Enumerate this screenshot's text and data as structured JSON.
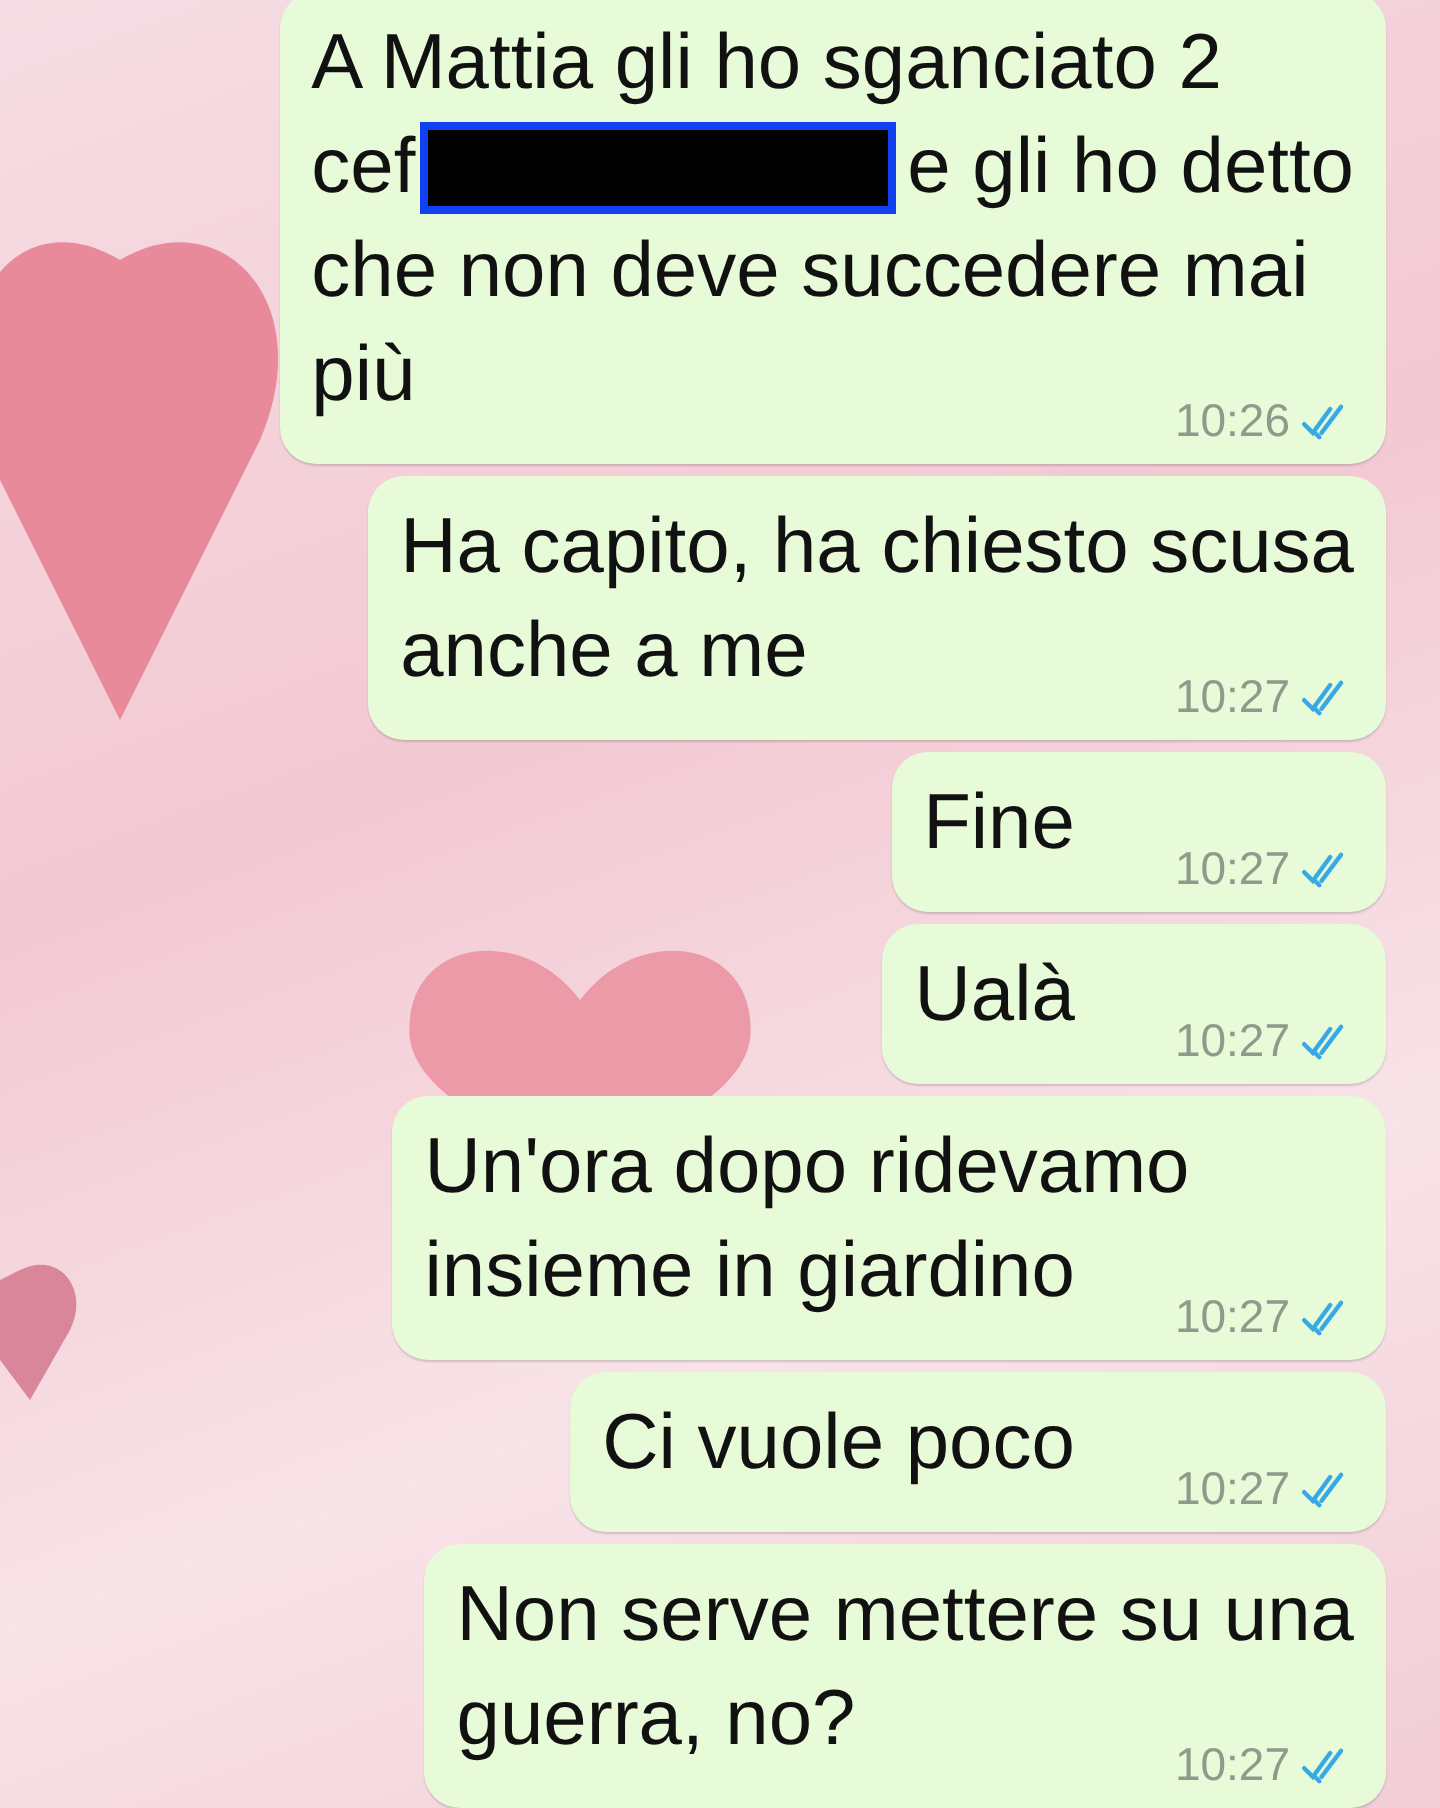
{
  "messages": [
    {
      "lines": [
        {
          "parts": [
            {
              "kind": "text",
              "text": "A Mattia gli ho sganciato 2"
            }
          ]
        },
        {
          "parts": [
            {
              "kind": "text",
              "text": "cef"
            },
            {
              "kind": "redaction"
            },
            {
              "kind": "text",
              "text": "e gli ho detto"
            }
          ]
        },
        {
          "parts": [
            {
              "kind": "text",
              "text": "che non deve succedere mai"
            }
          ]
        },
        {
          "parts": [
            {
              "kind": "text",
              "text": "più"
            }
          ]
        }
      ],
      "time": "10:26",
      "read": true
    },
    {
      "lines": [
        {
          "parts": [
            {
              "kind": "text",
              "text": "Ha capito, ha chiesto scusa"
            }
          ]
        },
        {
          "parts": [
            {
              "kind": "text",
              "text": "anche a me"
            }
          ]
        }
      ],
      "time": "10:27",
      "read": true
    },
    {
      "lines": [
        {
          "parts": [
            {
              "kind": "text",
              "text": "Fine"
            }
          ]
        }
      ],
      "time": "10:27",
      "read": true
    },
    {
      "lines": [
        {
          "parts": [
            {
              "kind": "text",
              "text": "Ualà"
            }
          ]
        }
      ],
      "time": "10:27",
      "read": true
    },
    {
      "lines": [
        {
          "parts": [
            {
              "kind": "text",
              "text": "Un'ora dopo ridevamo"
            }
          ]
        },
        {
          "parts": [
            {
              "kind": "text",
              "text": "insieme in giardino"
            }
          ]
        }
      ],
      "time": "10:27",
      "read": true
    },
    {
      "lines": [
        {
          "parts": [
            {
              "kind": "text",
              "text": "Ci vuole poco"
            }
          ]
        }
      ],
      "time": "10:27",
      "read": true
    },
    {
      "lines": [
        {
          "parts": [
            {
              "kind": "text",
              "text": "Non serve mettere su una"
            }
          ]
        },
        {
          "parts": [
            {
              "kind": "text",
              "text": "guerra, no?"
            }
          ]
        }
      ],
      "time": "10:27",
      "read": true
    }
  ]
}
